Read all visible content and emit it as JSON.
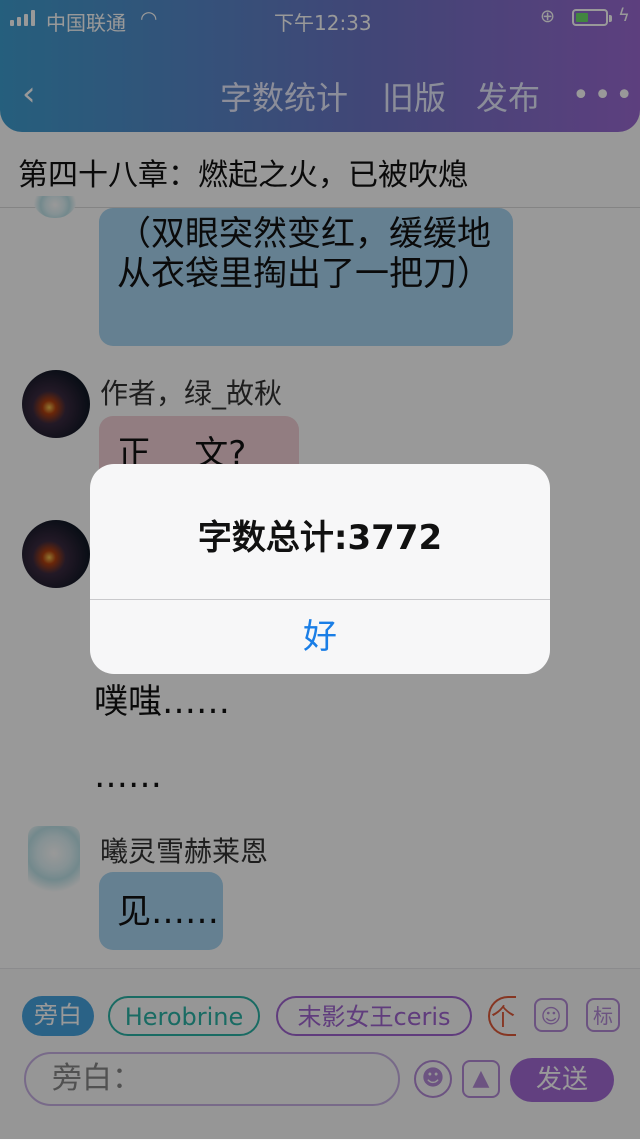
{
  "status_bar": {
    "carrier": "中国联通",
    "time": "下午12:33"
  },
  "nav": {
    "word_count": "字数统计",
    "old_version": "旧版",
    "publish": "发布",
    "more": "•••"
  },
  "chapter_title": "第四十八章：燃起之火，已被吹熄",
  "messages": {
    "m1_text": "（双眼突然变红，缓缓地从衣袋里掏出了一把刀）",
    "m2_name": "作者，绿_故秋",
    "m2_text": "正    文?",
    "m3_line1": "噗嗤……",
    "m3_line2": "……",
    "m4_name": "曦灵雪赫莱恩",
    "m4_text": "见……"
  },
  "bottom": {
    "chips": [
      "旁白",
      "Herobrine",
      "末影女王ceris",
      "个"
    ],
    "sq1_icon": "contact-card-icon",
    "sq2_label": "标",
    "input_placeholder": "旁白：",
    "send_label": "发送"
  },
  "dialog": {
    "message": "字数总计:3772",
    "ok_label": "好"
  },
  "colors": {
    "header_start": "#3f9ed0",
    "header_end": "#9b6ad3",
    "blue_bubble": "#a9d6f2",
    "accent_purple": "#a36bd6",
    "ios_blue": "#1a7ee6"
  }
}
